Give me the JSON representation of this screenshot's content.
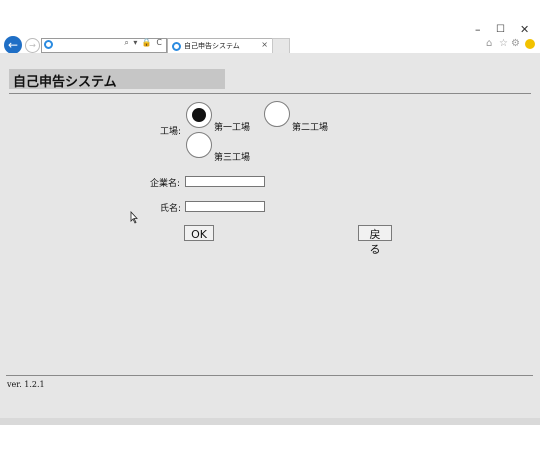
{
  "browser": {
    "window_controls": {
      "minimize": "–",
      "maximize": "☐",
      "close": "✕"
    },
    "back_glyph": "←",
    "forward_glyph": "→",
    "address_tools": "⌕ ▾ 🔒 C",
    "tab": {
      "title": "自己申告システム",
      "close": "×"
    },
    "toolbar_icons": [
      "home-icon",
      "star-icon",
      "gear-icon",
      "smiley-icon"
    ],
    "home_glyph": "⌂",
    "star_glyph": "☆",
    "gear_glyph": "⚙"
  },
  "page": {
    "title": "自己申告システム",
    "form": {
      "factory_label": "工場:",
      "factory_options": [
        {
          "label": "第一工場",
          "selected": true
        },
        {
          "label": "第二工場",
          "selected": false
        },
        {
          "label": "第三工場",
          "selected": false
        }
      ],
      "company_label": "企業名:",
      "company_value": "",
      "name_label": "氏名:",
      "name_value": "",
      "ok_label": "OK",
      "back_label": "戻る"
    },
    "version": "ver. 1.2.1"
  },
  "colors": {
    "content_bg": "#e6e6e6",
    "title_bar_bg": "#c6c6c6",
    "ie_blue": "#1f6fc6"
  }
}
